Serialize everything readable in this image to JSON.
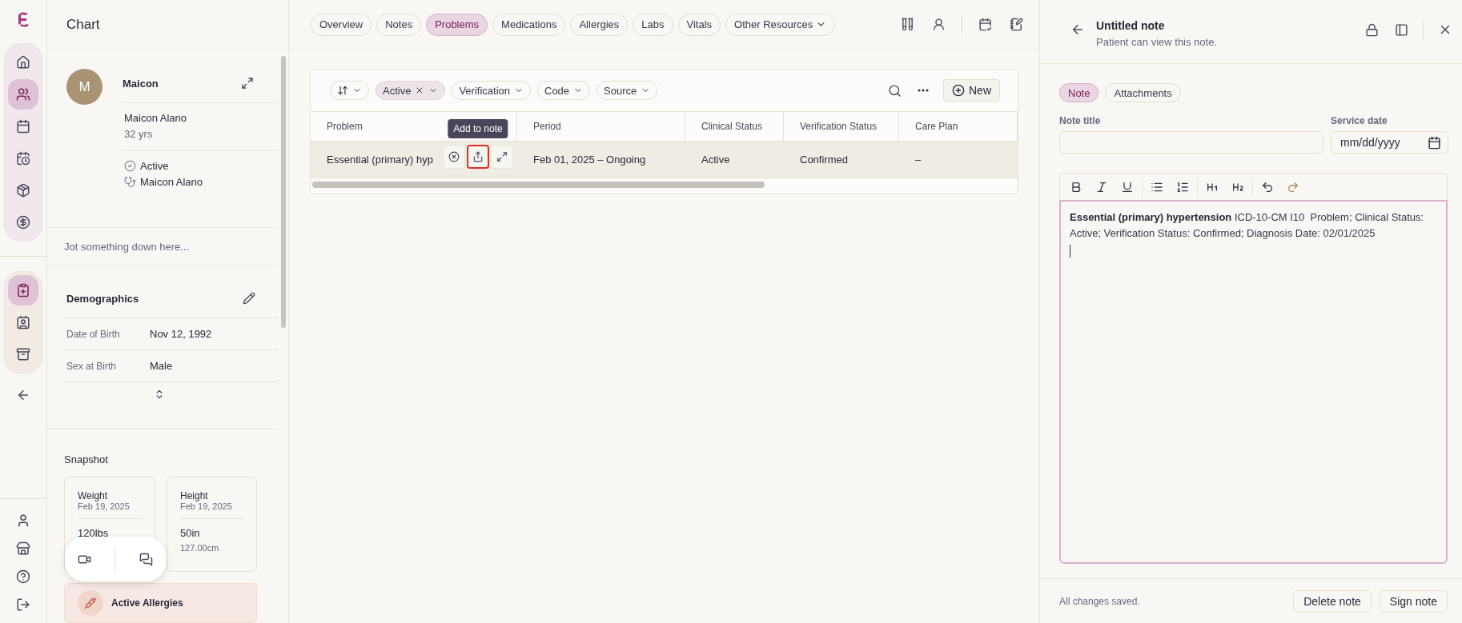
{
  "rail": {
    "main_items": [
      {
        "selected": false
      },
      {
        "selected": true
      },
      {
        "selected": false
      },
      {
        "selected": false
      },
      {
        "selected": false
      },
      {
        "selected": false
      }
    ],
    "chart_items": [
      {
        "selected": true
      },
      {
        "selected": false
      },
      {
        "selected": false
      }
    ]
  },
  "chart": {
    "title": "Chart",
    "patient": {
      "initial": "M",
      "short_name": "Maicon",
      "full_name": "Maicon Alano",
      "age": "32 yrs",
      "status": "Active",
      "provider": "Maicon Alano"
    },
    "jot_placeholder": "Jot something down here...",
    "demographics": {
      "title": "Demographics",
      "rows": [
        {
          "label": "Date of Birth",
          "value": "Nov 12, 1992"
        },
        {
          "label": "Sex at Birth",
          "value": "Male"
        }
      ]
    },
    "snapshot": {
      "title": "Snapshot",
      "cards": [
        {
          "label": "Weight",
          "date": "Feb 19, 2025",
          "value": "120lbs"
        },
        {
          "label": "Height",
          "date": "Feb 19, 2025",
          "value": "50in",
          "secondary": "127.00cm"
        }
      ]
    },
    "allergies": {
      "title": "Active Allergies"
    }
  },
  "tabs": [
    {
      "label": "Overview",
      "selected": false,
      "kind": "tab"
    },
    {
      "label": "Notes",
      "selected": false,
      "kind": "tab"
    },
    {
      "label": "Problems",
      "selected": true,
      "kind": "tab"
    },
    {
      "label": "Medications",
      "selected": false,
      "kind": "tab"
    },
    {
      "label": "Allergies",
      "selected": false,
      "kind": "tab"
    },
    {
      "label": "Labs",
      "selected": false,
      "kind": "tab"
    },
    {
      "label": "Vitals",
      "selected": false,
      "kind": "tab"
    },
    {
      "label": "Other Resources",
      "selected": false,
      "kind": "dropdown"
    }
  ],
  "filters": [
    {
      "kind": "sort"
    },
    {
      "kind": "applied",
      "label": "Active"
    },
    {
      "kind": "dropdown",
      "label": "Verification"
    },
    {
      "kind": "dropdown",
      "label": "Code"
    },
    {
      "kind": "dropdown",
      "label": "Source"
    }
  ],
  "new_button": "New",
  "table": {
    "columns": [
      "Problem",
      "Period",
      "Clinical Status",
      "Verification Status",
      "Care Plan"
    ],
    "rows": [
      {
        "highlighted": true,
        "cells": [
          "Essential (primary) hyp",
          "Feb 01, 2025 – Ongoing",
          "Active",
          "Confirmed",
          "–"
        ]
      }
    ],
    "row_actions": [
      {
        "focused": false
      },
      {
        "focused": true
      },
      {
        "focused": false
      }
    ],
    "tooltip": "Add to note"
  },
  "note": {
    "title": "Untitled note",
    "subtitle": "Patient can view this note.",
    "tabs": [
      {
        "label": "Note",
        "selected": true
      },
      {
        "label": "Attachments",
        "selected": false
      }
    ],
    "title_field": {
      "label": "Note title"
    },
    "date_field": {
      "label": "Service date",
      "placeholder": "mm/dd/yyyy"
    },
    "body": "**Essential (primary) hypertension** ICD-10-CM I10  Problem; Clinical Status: Active; Verification Status: Confirmed; Diagnosis Date: 02/01/2025",
    "status": "All changes saved.",
    "buttons": [
      "Delete note",
      "Sign note"
    ]
  }
}
